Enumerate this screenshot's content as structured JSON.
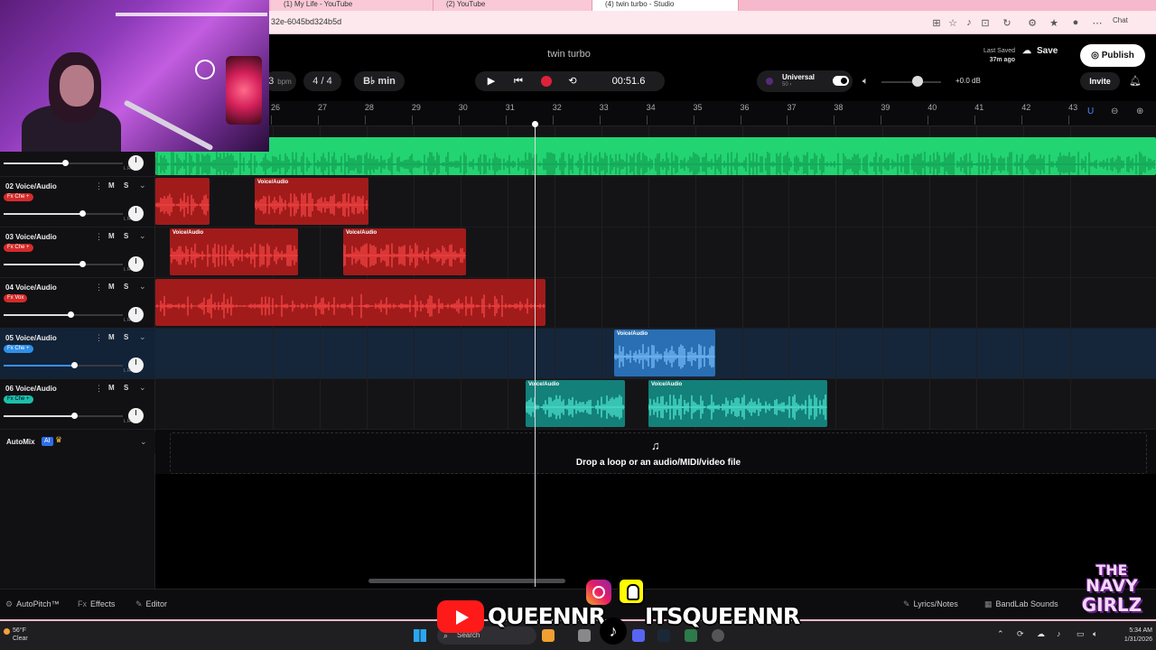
{
  "browser": {
    "tabs": [
      "(1) My Life - YouTube",
      "(2) YouTube",
      "(4) twin turbo - Studio"
    ],
    "url": "32e-6045bd324b5d",
    "chat_label": "Chat"
  },
  "header": {
    "project_title": "twin turbo",
    "last_saved_label": "Last Saved",
    "last_saved_time": "37m ago",
    "save_label": "Save",
    "publish_label": "Publish",
    "invite_label": "Invite",
    "bpm_value": "3",
    "bpm_unit": "bpm",
    "time_signature": "4 / 4",
    "key": "B♭ min",
    "time": "00:51.6",
    "instrument_name": "Universal",
    "instrument_sub": "50 ›",
    "volume_db": "+0.0 dB",
    "volume_level": 0.6
  },
  "ruler": {
    "bars": [
      "26",
      "27",
      "28",
      "29",
      "30",
      "31",
      "32",
      "33",
      "34",
      "35",
      "36",
      "37",
      "38",
      "39",
      "40",
      "41",
      "42",
      "43"
    ]
  },
  "tracks": [
    {
      "name": "",
      "fx": "",
      "fx_color": "",
      "volume": 0.45,
      "clip_label": "",
      "selected": false
    },
    {
      "name": "02 Voice/Audio",
      "fx": "Fx Che +",
      "fx_color": "red",
      "volume": 0.58,
      "clip_label": "Voice/Audio",
      "selected": false
    },
    {
      "name": "03 Voice/Audio",
      "fx": "Fx Che +",
      "fx_color": "red",
      "volume": 0.58,
      "clip_label": "Voice/Audio",
      "selected": false
    },
    {
      "name": "04 Voice/Audio",
      "fx": "Fx Vox",
      "fx_color": "red",
      "volume": 0.49,
      "clip_label": "",
      "selected": false
    },
    {
      "name": "05 Voice/Audio",
      "fx": "Fx Che +",
      "fx_color": "blue",
      "volume": 0.52,
      "clip_label": "Voice/Audio",
      "selected": true
    },
    {
      "name": "06 Voice/Audio",
      "fx": "Fx Che +",
      "fx_color": "teal",
      "volume": 0.52,
      "clip_label": "Voice/Audio",
      "selected": false
    }
  ],
  "track_buttons": {
    "mute": "M",
    "solo": "S",
    "pan_lr": "L    R"
  },
  "automix": {
    "label": "AutoMix",
    "badge": "AI"
  },
  "dropzone": {
    "text": "Drop a loop or an audio/MIDI/video file"
  },
  "bottombar": {
    "autopitch": "AutoPitch™",
    "effects": "Effects",
    "effects_prefix": "Fx",
    "editor": "Editor",
    "lyrics": "Lyrics/Notes",
    "sounds": "BandLab Sounds"
  },
  "overlay": {
    "youtube_handle": "QUEENNR",
    "social_handle": "ITSQUEENNR",
    "logo_lines": [
      "THE",
      "NAVY",
      "GIRLZ"
    ]
  },
  "taskbar": {
    "temp": "56°F",
    "weather": "Clear",
    "search": "Search",
    "time": "5:34 AM",
    "date": "1/31/2026"
  },
  "colors": {
    "green_clip": "#22d472",
    "red_clip": "#a11b1b",
    "blue_clip": "#2a6fb4",
    "teal_clip": "#13807a",
    "record": "#e0213a"
  }
}
